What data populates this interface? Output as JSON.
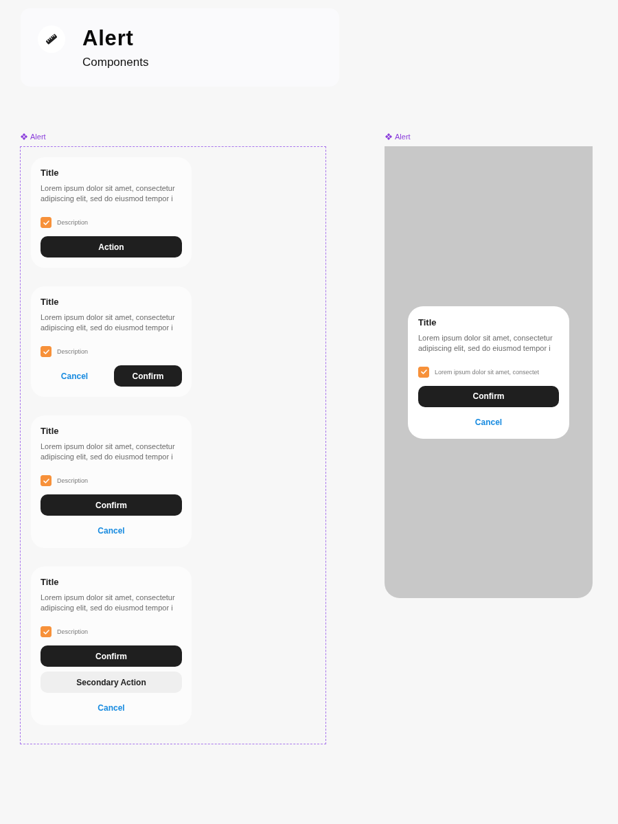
{
  "header": {
    "title": "Alert",
    "subtitle": "Components"
  },
  "frames": [
    {
      "kind": "variants",
      "label": "Alert",
      "alerts": [
        {
          "title": "Title",
          "body": "Lorem ipsum dolor sit amet, consectetur adipiscing elit, sed do eiusmod tempor i",
          "checkbox": {
            "label": "Description",
            "checked": true
          },
          "inline_actions": false,
          "actions": [
            {
              "label": "Action",
              "kind": "primary"
            }
          ]
        },
        {
          "title": "Title",
          "body": "Lorem ipsum dolor sit amet, consectetur adipiscing elit, sed do eiusmod tempor i",
          "checkbox": {
            "label": "Description",
            "checked": true
          },
          "inline_actions": true,
          "actions": [
            {
              "label": "Cancel",
              "kind": "link"
            },
            {
              "label": "Confirm",
              "kind": "primary"
            }
          ]
        },
        {
          "title": "Title",
          "body": "Lorem ipsum dolor sit amet, consectetur adipiscing elit, sed do eiusmod tempor i",
          "checkbox": {
            "label": "Description",
            "checked": true
          },
          "inline_actions": false,
          "actions": [
            {
              "label": "Confirm",
              "kind": "primary"
            },
            {
              "label": "Cancel",
              "kind": "link"
            }
          ]
        },
        {
          "title": "Title",
          "body": "Lorem ipsum dolor sit amet, consectetur adipiscing elit, sed do eiusmod tempor i",
          "checkbox": {
            "label": "Description",
            "checked": true
          },
          "inline_actions": false,
          "actions": [
            {
              "label": "Confirm",
              "kind": "primary"
            },
            {
              "label": "Secondary Action",
              "kind": "secondary"
            },
            {
              "label": "Cancel",
              "kind": "link"
            }
          ]
        }
      ]
    },
    {
      "kind": "overlay",
      "label": "Alert",
      "alerts": [
        {
          "title": "Title",
          "body": "Lorem ipsum dolor sit amet, consectetur adipiscing elit, sed do eiusmod tempor i",
          "checkbox": {
            "label": "Lorem ipsum dolor sit amet, consectet",
            "checked": true
          },
          "inline_actions": false,
          "actions": [
            {
              "label": "Confirm",
              "kind": "primary"
            },
            {
              "label": "Cancel",
              "kind": "link"
            }
          ]
        }
      ]
    }
  ]
}
